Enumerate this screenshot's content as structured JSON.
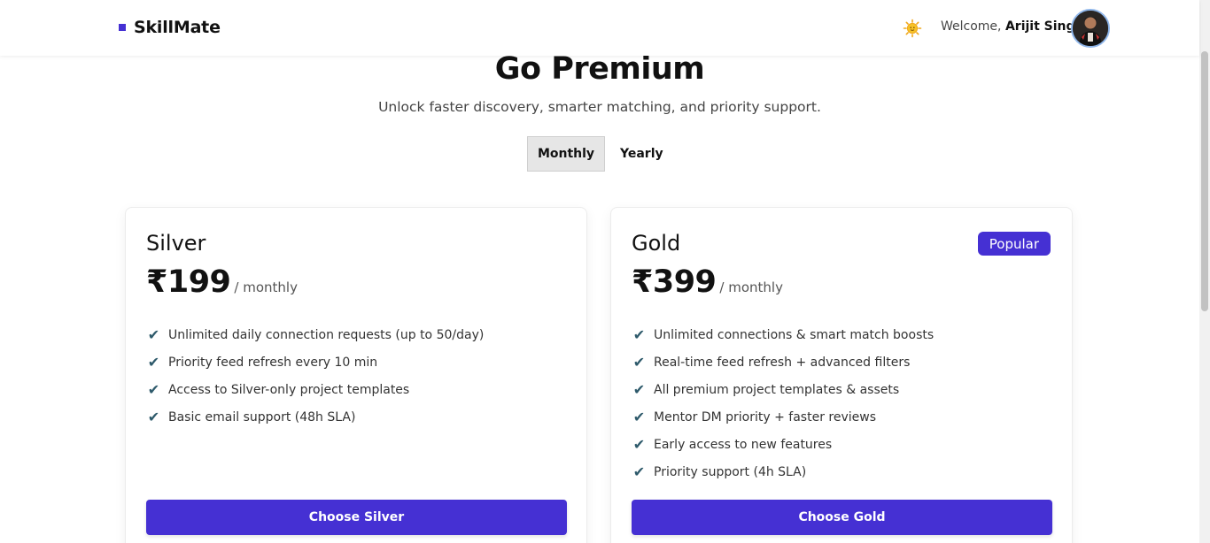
{
  "header": {
    "brand": "SkillMate",
    "welcome_prefix": "Welcome,",
    "user_name": "Arijit Singh"
  },
  "hero": {
    "title": "Go Premium",
    "subtitle": "Unlock faster discovery, smarter matching, and priority support."
  },
  "billing_toggle": {
    "options": [
      "Monthly",
      "Yearly"
    ],
    "selected": "Monthly"
  },
  "plans": [
    {
      "name": "Silver",
      "price": "₹199",
      "period": "/ monthly",
      "features": [
        "Unlimited daily connection requests (up to 50/day)",
        "Priority feed refresh every 10 min",
        "Access to Silver-only project templates",
        "Basic email support (48h SLA)"
      ],
      "cta": "Choose Silver"
    },
    {
      "name": "Gold",
      "price": "₹399",
      "period": "/ monthly",
      "badge": "Popular",
      "features": [
        "Unlimited connections & smart match boosts",
        "Real-time feed refresh + advanced filters",
        "All premium project templates & assets",
        "Mentor DM priority + faster reviews",
        "Early access to new features",
        "Priority support (4h SLA)"
      ],
      "cta": "Choose Gold"
    }
  ],
  "colors": {
    "accent": "#4530d3",
    "check": "#2e5a6b",
    "avatar_ring": "#8fb6ea"
  },
  "icons": {
    "theme_toggle": "sun-icon",
    "feature_check": "check-icon"
  }
}
